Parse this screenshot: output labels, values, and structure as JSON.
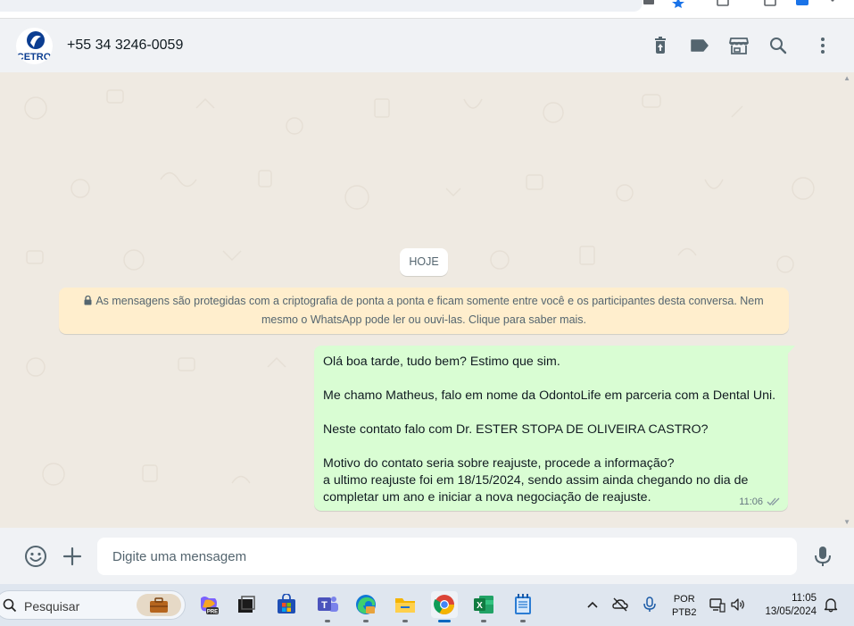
{
  "header": {
    "contact_name": "+55 34 3246-0059",
    "avatar_text": "CETRO",
    "icons": [
      "delete-icon",
      "label-icon",
      "store-icon",
      "search-icon",
      "menu-icon"
    ]
  },
  "chat": {
    "date_label": "HOJE",
    "encryption_notice": {
      "line1": "As mensagens são protegidas com a criptografia de ponta a ponta e ficam somente entre você e os participantes desta conversa. Nem",
      "line2": "mesmo o WhatsApp pode ler ou ouvi-las. Clique para saber mais."
    },
    "message": {
      "lines": [
        "Olá boa tarde, tudo bem? Estimo que sim.",
        "Me chamo Matheus, falo em nome da OdontoLife em parceria com a Dental Uni.",
        "Neste contato falo com Dr. ESTER STOPA DE OLIVEIRA CASTRO?",
        "Motivo do contato seria sobre reajuste, procede a informação?",
        "a ultimo reajuste foi em 18/15/2024, sendo assim ainda chegando no dia de",
        "completar um ano e iniciar a nova negociação de reajuste."
      ],
      "time": "11:06",
      "status": "delivered-double-check",
      "colors": {
        "bubble": "#d9fdd3",
        "text": "#111b21"
      }
    }
  },
  "composer": {
    "placeholder": "Digite uma mensagem",
    "icons": [
      "emoji-icon",
      "plus-icon",
      "mic-icon"
    ]
  },
  "taskbar": {
    "search_label": "Pesquisar",
    "apps": [
      "work-briefcase",
      "copilot-pre",
      "app-dark",
      "microsoft-store",
      "teams",
      "edge",
      "file-explorer",
      "chrome",
      "excel",
      "notepad"
    ],
    "language": {
      "line1": "POR",
      "line2": "PTB2"
    },
    "time": "11:05",
    "date": "13/05/2024"
  },
  "colors": {
    "chat_background": "#efeae2",
    "header_background": "#f0f2f5",
    "notice_background": "#ffeecd",
    "taskbar_background": "#dfe6ef",
    "icon_color": "#54656f"
  }
}
